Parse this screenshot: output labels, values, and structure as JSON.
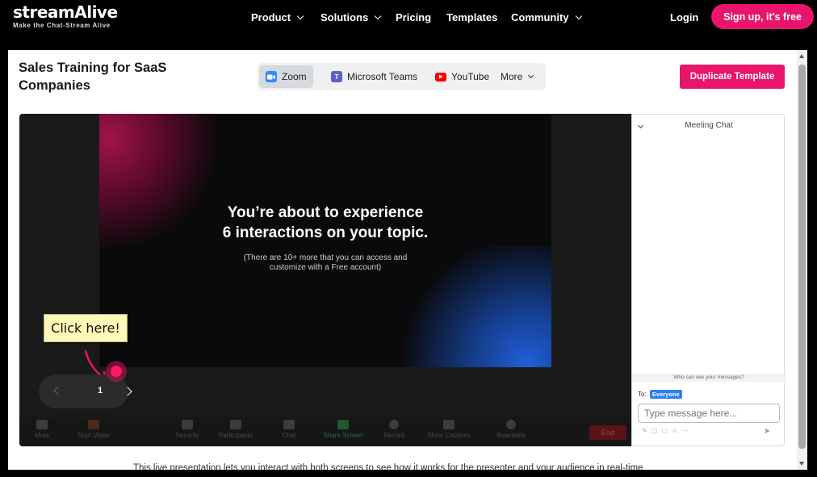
{
  "brand": {
    "name": "streamAlive",
    "tagline": "Make the Chat-Stream Alive"
  },
  "nav": {
    "items": [
      {
        "label": "Product",
        "dropdown": true
      },
      {
        "label": "Solutions",
        "dropdown": true
      },
      {
        "label": "Pricing",
        "dropdown": false
      },
      {
        "label": "Templates",
        "dropdown": false
      },
      {
        "label": "Community",
        "dropdown": true
      }
    ],
    "login": "Login",
    "signup": "Sign up, it's free"
  },
  "page": {
    "title": "Sales Training for SaaS Companies",
    "platforms": [
      {
        "label": "Zoom",
        "icon": "zoom-icon",
        "active": true
      },
      {
        "label": "Microsoft Teams",
        "icon": "teams-icon",
        "active": false
      },
      {
        "label": "YouTube",
        "icon": "youtube-icon",
        "active": false
      },
      {
        "label": "More",
        "icon": "chevron-down-icon",
        "active": false
      }
    ],
    "duplicate_button": "Duplicate Template",
    "footer_text": "This live presentation lets you interact with both screens to see how it works for the presenter and your audience in real-time"
  },
  "slide": {
    "headline_line1": "You’re about to experience",
    "headline_line2": "6 interactions on your topic.",
    "sub_line1": "(There are 10+ more that you can access and",
    "sub_line2": "customize with a Free account)",
    "callout": "Click here!",
    "page_number": "1"
  },
  "zoom_toolbar": {
    "items": [
      "Mute",
      "Start Video",
      "Security",
      "Participants",
      "Chat",
      "Share Screen",
      "Record",
      "Show Captions",
      "Reactions"
    ],
    "end": "End"
  },
  "chat": {
    "title": "Meeting Chat",
    "who_can_see": "Who can see your messages?",
    "to_label": "To:",
    "recipient": "Everyone",
    "placeholder": "Type message here..."
  }
}
